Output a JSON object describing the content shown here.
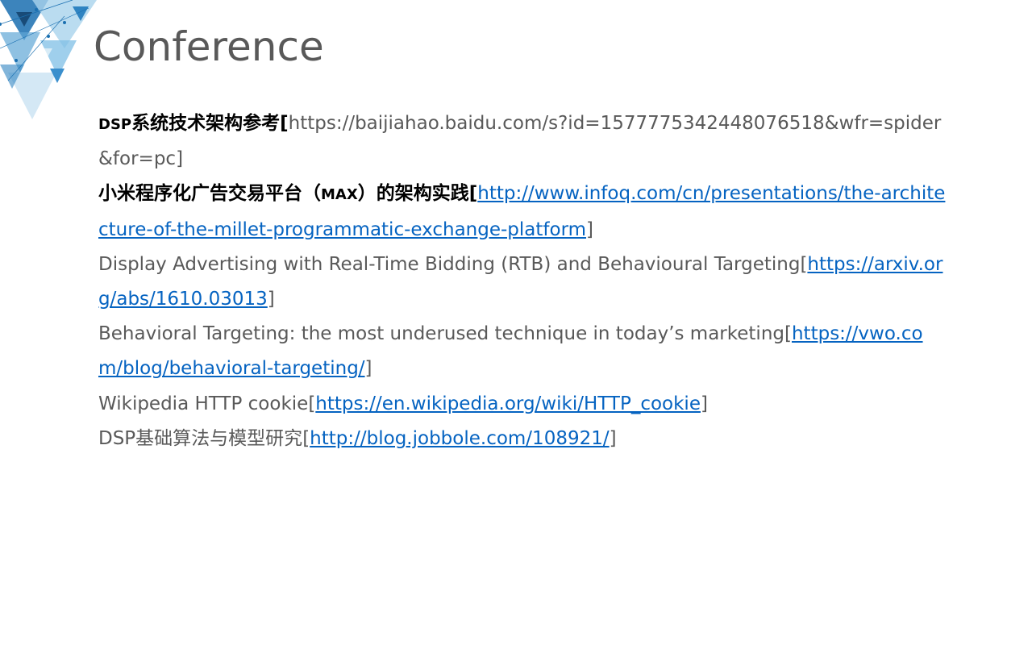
{
  "slide": {
    "title": "Conference"
  },
  "colors": {
    "title": "#595959",
    "body_text": "#595959",
    "bold_text": "#000000",
    "link": "#0563c1",
    "decor_blue": "#1a6fb0",
    "decor_light": "#a9d3ec"
  },
  "icons": {
    "corner_decoration": "triangle-pattern-icon"
  },
  "references": [
    {
      "label_bold_prefix": "DSP",
      "label_bold": "系统技术架构参考",
      "open": "[",
      "plain_url": "https://baijiahao.baidu.com/s?id=1577775342448076518&wfr=spider&for=pc",
      "close": "]"
    },
    {
      "label_bold": "小米程序化广告交易平台（",
      "label_bold_small": "MAX",
      "label_bold_after": "）的架构实践",
      "open": "[",
      "url": "http://www.infoq.com/cn/presentations/the-architecture-of-the-millet-programmatic-exchange-platform",
      "close": "]"
    },
    {
      "label": "Display Advertising with Real-Time Bidding (RTB) and Behavioural Targeting",
      "open": "[",
      "url": "https://arxiv.org/abs/1610.03013",
      "close": "]"
    },
    {
      "label": "Behavioral Targeting: the most underused technique in today’s marketing",
      "open": "[",
      "url": "https://vwo.com/blog/behavioral-targeting/",
      "close": "]"
    },
    {
      "label": "Wikipedia HTTP cookie",
      "open": "[",
      "url": "https://en.wikipedia.org/wiki/HTTP_cookie",
      "close": "]"
    },
    {
      "label": "DSP基础算法与模型研究",
      "open": "[",
      "url": "http://blog.jobbole.com/108921/",
      "close": "]"
    }
  ]
}
